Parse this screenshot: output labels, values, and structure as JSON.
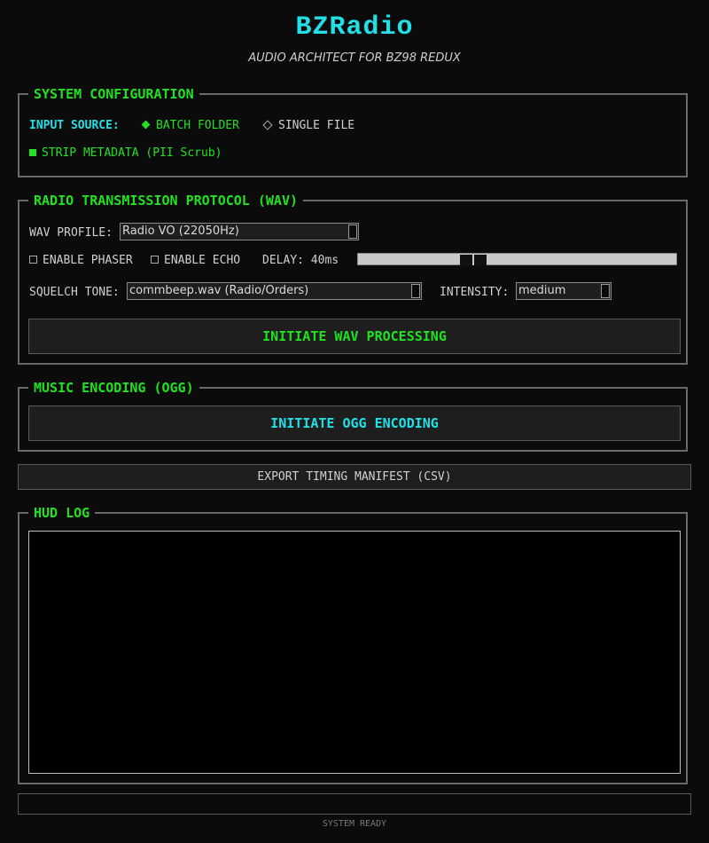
{
  "app": {
    "title": "BZRadio",
    "subtitle": "AUDIO ARCHITECT FOR BZ98 REDUX"
  },
  "system_config": {
    "legend": "SYSTEM CONFIGURATION",
    "input_source_label": "INPUT SOURCE:",
    "options": [
      {
        "label": "BATCH FOLDER",
        "selected": true
      },
      {
        "label": "SINGLE FILE",
        "selected": false
      }
    ],
    "strip_metadata": {
      "label": "STRIP METADATA (PII Scrub)",
      "checked": true
    }
  },
  "radio_protocol": {
    "legend": "RADIO TRANSMISSION PROTOCOL (WAV)",
    "wav_profile_label": "WAV PROFILE:",
    "wav_profile_value": "Radio VO (22050Hz)",
    "phaser": {
      "label": "ENABLE PHASER",
      "checked": false
    },
    "echo": {
      "label": "ENABLE ECHO",
      "checked": false
    },
    "delay_label": "DELAY: 40ms",
    "delay_slider_fraction": 0.35,
    "squelch_label": "SQUELCH TONE:",
    "squelch_value": "commbeep.wav (Radio/Orders)",
    "intensity_label": "INTENSITY:",
    "intensity_value": "medium",
    "process_button": "INITIATE WAV PROCESSING"
  },
  "music_encoding": {
    "legend": "MUSIC ENCODING (OGG)",
    "encode_button": "INITIATE OGG ENCODING"
  },
  "export_button": "EXPORT TIMING MANIFEST (CSV)",
  "hud_log": {
    "legend": "HUD LOG"
  },
  "status": {
    "text": "SYSTEM READY"
  },
  "colors": {
    "accent_cyan": "#21e0e6",
    "accent_green": "#22e022",
    "background": "#0b0b0b"
  }
}
